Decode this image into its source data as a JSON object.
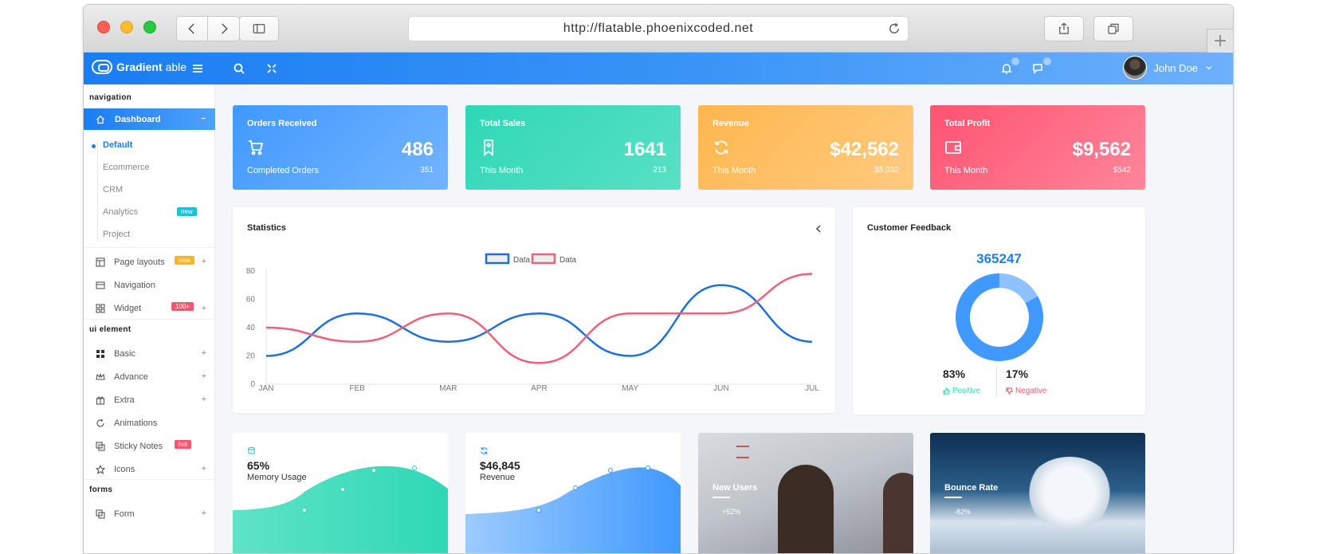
{
  "browser": {
    "url": "http://flatable.phoenixcoded.net",
    "new_tab_symbol": "+"
  },
  "app": {
    "brand_bold": "Gradient",
    "brand_light": "able",
    "user_name": "John Doe",
    "accent": "#1b7df3"
  },
  "sidebar": {
    "section_navigation": "navigation",
    "dashboard": "Dashboard",
    "dashboard_sub": [
      "Default",
      "Ecommerce",
      "CRM",
      "Analytics",
      "Project"
    ],
    "analytics_tag": "new",
    "page_layouts": "Page layouts",
    "page_layouts_tag": "new",
    "navigation": "Navigation",
    "widget": "Widget",
    "widget_tag": "100+",
    "section_ui": "ui element",
    "basic": "Basic",
    "advance": "Advance",
    "extra": "Extra",
    "animations": "Animations",
    "sticky_notes": "Sticky Notes",
    "sticky_tag": "hot",
    "icons": "Icons",
    "section_forms": "forms",
    "form": "Form",
    "plus": "+"
  },
  "stats": [
    {
      "title": "Orders Received",
      "value": "486",
      "sub": "Completed Orders",
      "sub_value": "351",
      "icon": "cart-icon"
    },
    {
      "title": "Total Sales",
      "value": "1641",
      "sub": "This Month",
      "sub_value": "213",
      "icon": "tag-icon"
    },
    {
      "title": "Revenue",
      "value": "$42,562",
      "sub": "This Month",
      "sub_value": "$5,032",
      "icon": "refresh-icon"
    },
    {
      "title": "Total Profit",
      "value": "$9,562",
      "sub": "This Month",
      "sub_value": "$542",
      "icon": "wallet-icon"
    }
  ],
  "statistics": {
    "title": "Statistics"
  },
  "chart_data": {
    "type": "line",
    "categories": [
      "JAN",
      "FEB",
      "MAR",
      "APR",
      "MAY",
      "JUN",
      "JUL"
    ],
    "ylim": [
      0,
      80
    ],
    "yticks": [
      0,
      20,
      40,
      60,
      80
    ],
    "series": [
      {
        "name": "Data",
        "color": "#1b6fe0",
        "values": [
          20,
          50,
          30,
          50,
          20,
          70,
          30
        ]
      },
      {
        "name": "Data",
        "color": "#f0607a",
        "values": [
          40,
          30,
          50,
          15,
          50,
          50,
          78
        ]
      }
    ]
  },
  "feedback": {
    "title": "Customer Feedback",
    "total": "365247",
    "positive_pct": "83%",
    "positive_label": "Positive",
    "negative_pct": "17%",
    "negative_label": "Negative",
    "positive_value": 83,
    "negative_value": 17
  },
  "mini": [
    {
      "value": "65%",
      "label": "Memory Usage"
    },
    {
      "value": "$46,845",
      "label": "Revenue"
    }
  ],
  "photo_cards": [
    {
      "title": "New Users",
      "stat": "+52%"
    },
    {
      "title": "Bounce Rate",
      "stat": "-82%"
    }
  ]
}
